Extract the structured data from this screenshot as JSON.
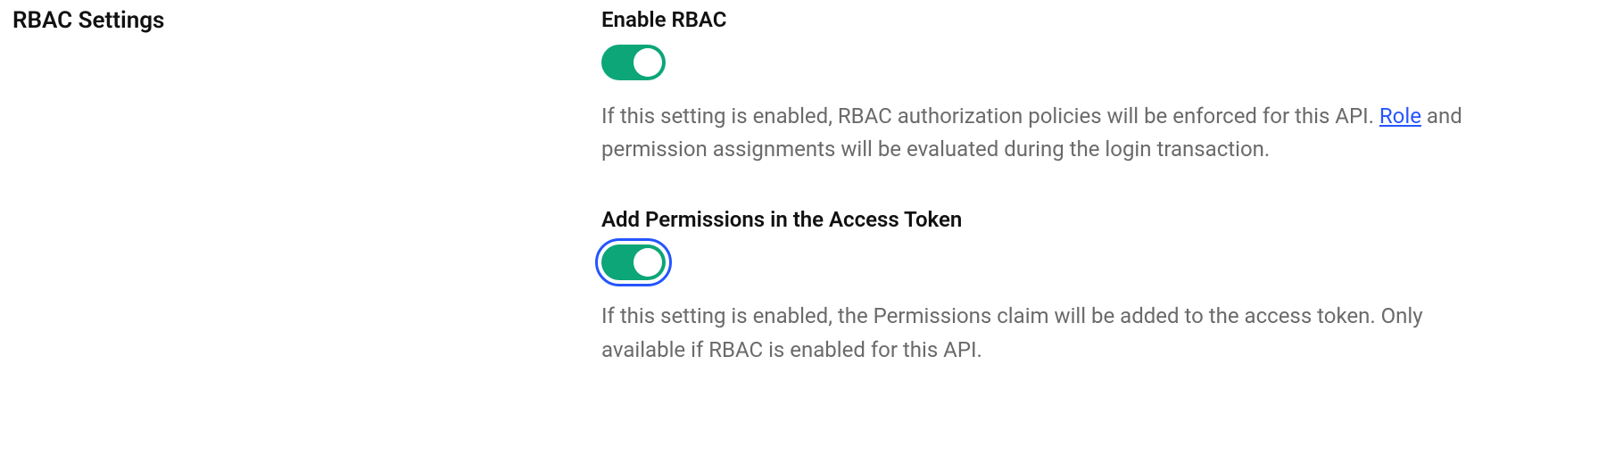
{
  "section": {
    "title": "RBAC Settings"
  },
  "settings": {
    "enable_rbac": {
      "label": "Enable RBAC",
      "enabled": true,
      "desc_before": "If this setting is enabled, RBAC authorization policies will be enforced for this API. ",
      "link_text": "Role",
      "desc_after": " and permission assignments will be evaluated during the login transaction."
    },
    "add_permissions": {
      "label": "Add Permissions in the Access Token",
      "enabled": true,
      "description": "If this setting is enabled, the Permissions claim will be added to the access token. Only available if RBAC is enabled for this API."
    }
  },
  "colors": {
    "toggle_on": "#0ca678",
    "focus_ring": "#2555ff",
    "text_muted": "#6a6a6a"
  }
}
